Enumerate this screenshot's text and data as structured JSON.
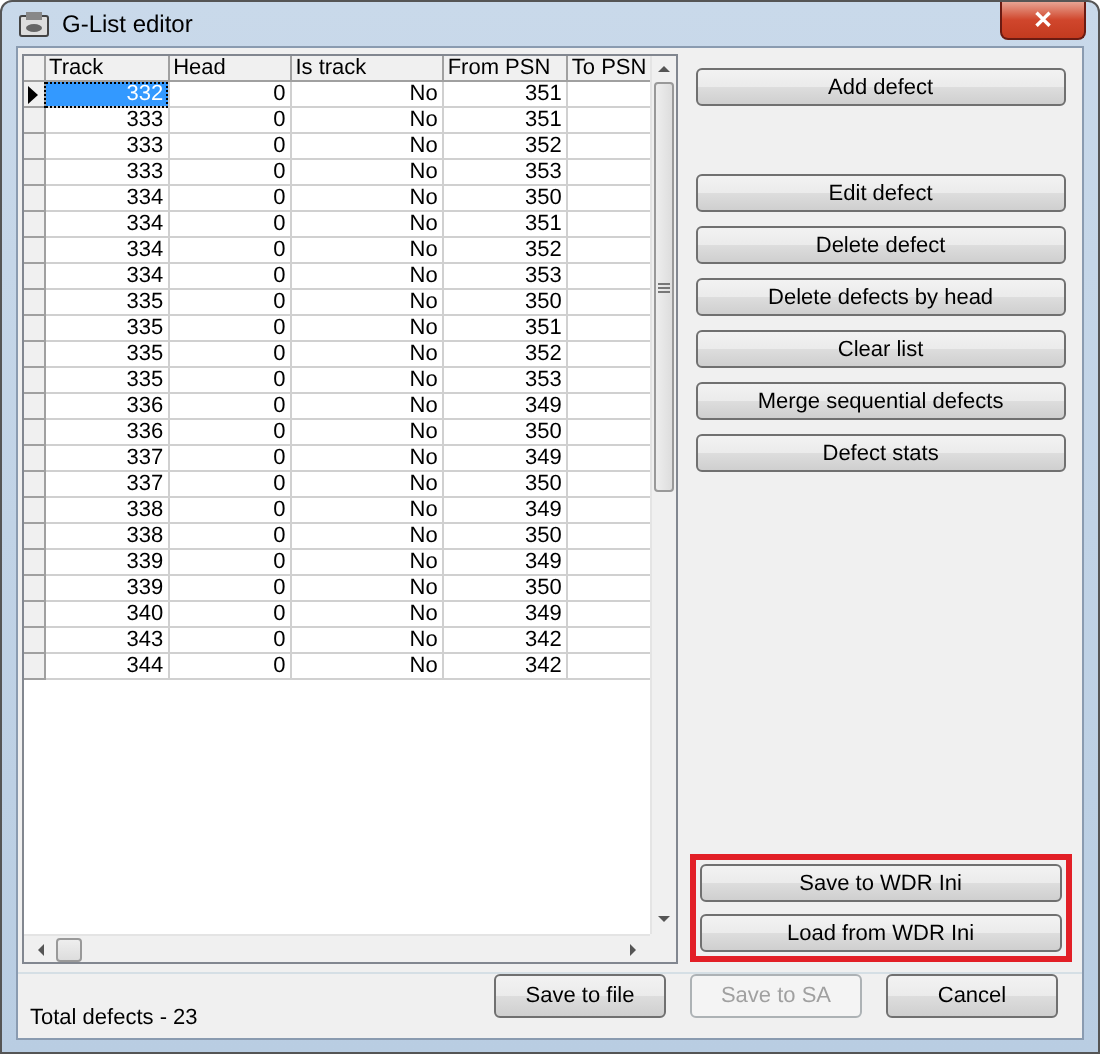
{
  "window": {
    "title": "G-List editor",
    "close": "✕"
  },
  "table": {
    "columns": [
      "Track",
      "Head",
      "Is track",
      "From PSN",
      "To PSN"
    ],
    "rows": [
      {
        "cells": [
          "332",
          "0",
          "No",
          "351",
          ""
        ],
        "selected": true
      },
      {
        "cells": [
          "333",
          "0",
          "No",
          "351",
          ""
        ],
        "selected": false
      },
      {
        "cells": [
          "333",
          "0",
          "No",
          "352",
          ""
        ],
        "selected": false
      },
      {
        "cells": [
          "333",
          "0",
          "No",
          "353",
          ""
        ],
        "selected": false
      },
      {
        "cells": [
          "334",
          "0",
          "No",
          "350",
          ""
        ],
        "selected": false
      },
      {
        "cells": [
          "334",
          "0",
          "No",
          "351",
          ""
        ],
        "selected": false
      },
      {
        "cells": [
          "334",
          "0",
          "No",
          "352",
          ""
        ],
        "selected": false
      },
      {
        "cells": [
          "334",
          "0",
          "No",
          "353",
          ""
        ],
        "selected": false
      },
      {
        "cells": [
          "335",
          "0",
          "No",
          "350",
          ""
        ],
        "selected": false
      },
      {
        "cells": [
          "335",
          "0",
          "No",
          "351",
          ""
        ],
        "selected": false
      },
      {
        "cells": [
          "335",
          "0",
          "No",
          "352",
          ""
        ],
        "selected": false
      },
      {
        "cells": [
          "335",
          "0",
          "No",
          "353",
          ""
        ],
        "selected": false
      },
      {
        "cells": [
          "336",
          "0",
          "No",
          "349",
          ""
        ],
        "selected": false
      },
      {
        "cells": [
          "336",
          "0",
          "No",
          "350",
          ""
        ],
        "selected": false
      },
      {
        "cells": [
          "337",
          "0",
          "No",
          "349",
          ""
        ],
        "selected": false
      },
      {
        "cells": [
          "337",
          "0",
          "No",
          "350",
          ""
        ],
        "selected": false
      },
      {
        "cells": [
          "338",
          "0",
          "No",
          "349",
          ""
        ],
        "selected": false
      },
      {
        "cells": [
          "338",
          "0",
          "No",
          "350",
          ""
        ],
        "selected": false
      },
      {
        "cells": [
          "339",
          "0",
          "No",
          "349",
          ""
        ],
        "selected": false
      },
      {
        "cells": [
          "339",
          "0",
          "No",
          "350",
          ""
        ],
        "selected": false
      },
      {
        "cells": [
          "340",
          "0",
          "No",
          "349",
          ""
        ],
        "selected": false
      },
      {
        "cells": [
          "343",
          "0",
          "No",
          "342",
          ""
        ],
        "selected": false
      },
      {
        "cells": [
          "344",
          "0",
          "No",
          "342",
          ""
        ],
        "selected": false
      }
    ]
  },
  "top_buttons": [
    {
      "label": "Add defect",
      "disabled": false
    }
  ],
  "action_buttons": [
    {
      "label": "Edit defect",
      "disabled": false
    },
    {
      "label": "Delete defect",
      "disabled": false
    },
    {
      "label": "Delete defects by head",
      "disabled": false
    },
    {
      "label": "Clear list",
      "disabled": false
    },
    {
      "label": "Merge sequential defects",
      "disabled": false
    },
    {
      "label": "Defect stats",
      "disabled": false
    }
  ],
  "highlighted_buttons": [
    {
      "label": "Save to WDR Ini",
      "disabled": false
    },
    {
      "label": "Load from WDR Ini",
      "disabled": false
    }
  ],
  "status": "Total defects - 23",
  "bottom_buttons": [
    {
      "label": "Save to file",
      "disabled": false
    },
    {
      "label": "Save to SA",
      "disabled": true
    },
    {
      "label": "Cancel",
      "disabled": false
    }
  ]
}
